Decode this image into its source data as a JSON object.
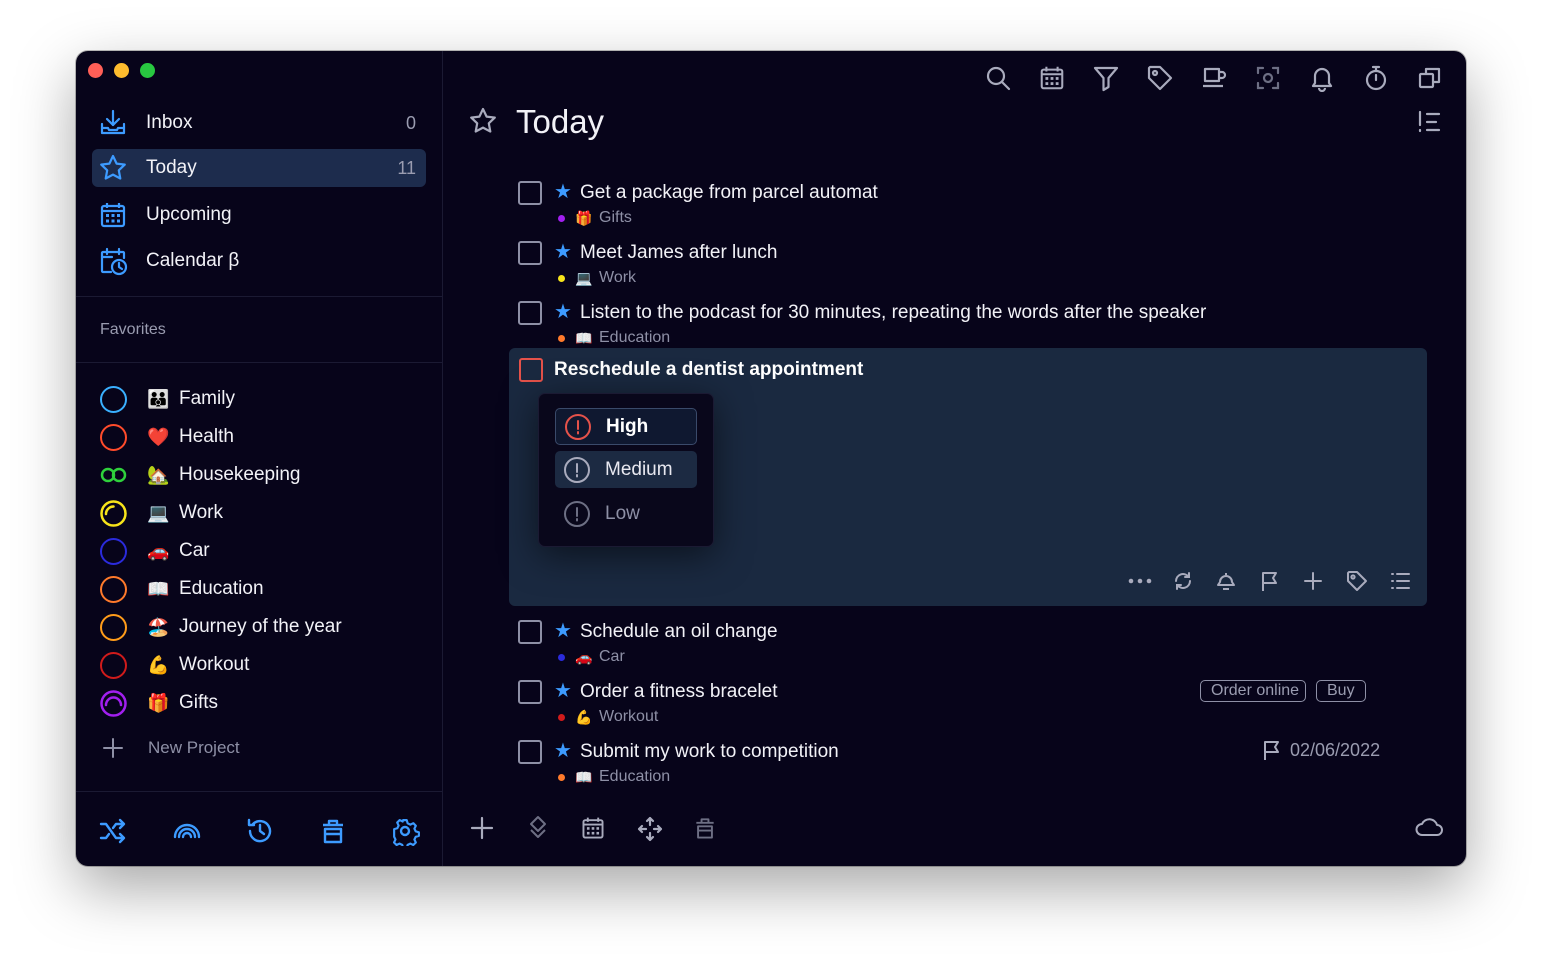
{
  "sidebar": {
    "nav": [
      {
        "label": "Inbox",
        "count": "0",
        "icon": "inbox-icon"
      },
      {
        "label": "Today",
        "count": "11",
        "icon": "star-icon"
      },
      {
        "label": "Upcoming",
        "count": "",
        "icon": "calendar-grid-icon"
      },
      {
        "label": "Calendar β",
        "count": "",
        "icon": "calendar-clock-icon"
      }
    ],
    "favorites_title": "Favorites",
    "projects": [
      {
        "label": "Family",
        "emoji": "👪",
        "color": "#3ab0ff"
      },
      {
        "label": "Health",
        "emoji": "❤️",
        "color": "#ff4b2b"
      },
      {
        "label": "Housekeeping",
        "emoji": "🏡",
        "color": "#2fd13c"
      },
      {
        "label": "Work",
        "emoji": "💻",
        "color": "#f7e41a"
      },
      {
        "label": "Car",
        "emoji": "🚗",
        "color": "#2b2bdc"
      },
      {
        "label": "Education",
        "emoji": "📖",
        "color": "#ff7a2b"
      },
      {
        "label": "Journey of the year",
        "emoji": "🏖️",
        "color": "#ff9c1a"
      },
      {
        "label": "Workout",
        "emoji": "💪",
        "color": "#d01b1b"
      },
      {
        "label": "Gifts",
        "emoji": "🎁",
        "color": "#a21ff0"
      }
    ],
    "new_project": "New Project"
  },
  "header": {
    "title": "Today"
  },
  "tasks": [
    {
      "title": "Get a package from parcel automat",
      "project": "Gifts",
      "emoji": "🎁",
      "dot": "#a21ff0"
    },
    {
      "title": "Meet James after lunch",
      "project": "Work",
      "emoji": "💻",
      "dot": "#f7e41a"
    },
    {
      "title": "Listen to the podcast for 30 minutes, repeating the words after the speaker",
      "project": "Education",
      "emoji": "📖",
      "dot": "#ff7a2b"
    },
    {
      "title": "Schedule an oil change",
      "project": "Car",
      "emoji": "🚗",
      "dot": "#2b2bdc"
    },
    {
      "title": "Order a fitness bracelet",
      "project": "Workout",
      "emoji": "💪",
      "dot": "#d01b1b",
      "tags": [
        "Order online",
        "Buy"
      ]
    },
    {
      "title": "Submit my work to competition",
      "project": "Education",
      "emoji": "📖",
      "dot": "#ff7a2b",
      "due": "02/06/2022"
    }
  ],
  "expanded_task": {
    "title": "Reschedule a dentist appointment",
    "priority_menu": [
      {
        "label": "High",
        "selected": true
      },
      {
        "label": "Medium",
        "selected": false
      },
      {
        "label": "Low",
        "selected": false
      }
    ]
  },
  "colors": {
    "accent": "#3d9bff",
    "high_priority": "#e5524a",
    "background": "#07041a",
    "selection": "#1d2c4d"
  }
}
